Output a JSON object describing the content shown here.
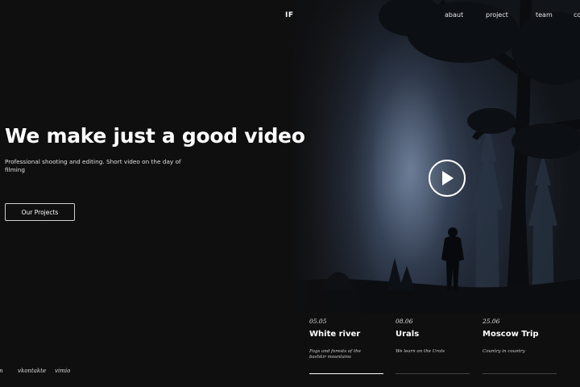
{
  "header": {
    "logo": "IF",
    "nav": [
      {
        "label": "abaut"
      },
      {
        "label": "project"
      },
      {
        "label": "team"
      },
      {
        "label": "co"
      }
    ]
  },
  "hero": {
    "title": "We make just a good video",
    "subtitle": "Professional shooting and editing. Short video on the day of filming",
    "cta_label": "Our Projects"
  },
  "player": {
    "icon": "play-icon"
  },
  "projects": [
    {
      "date": "05.05",
      "title": "White river",
      "desc": "Fogs and forests of the bashkir mountains"
    },
    {
      "date": "08.06",
      "title": "Urals",
      "desc": "We learn on the Urals"
    },
    {
      "date": "25.06",
      "title": "Moscow Trip",
      "desc": "Country in country"
    }
  ],
  "socials": [
    {
      "label": "m"
    },
    {
      "label": "vkontakte"
    },
    {
      "label": "vimio"
    }
  ],
  "colors": {
    "background": "#0f0f10",
    "text": "#ffffff",
    "active_line": "#ffffff"
  }
}
